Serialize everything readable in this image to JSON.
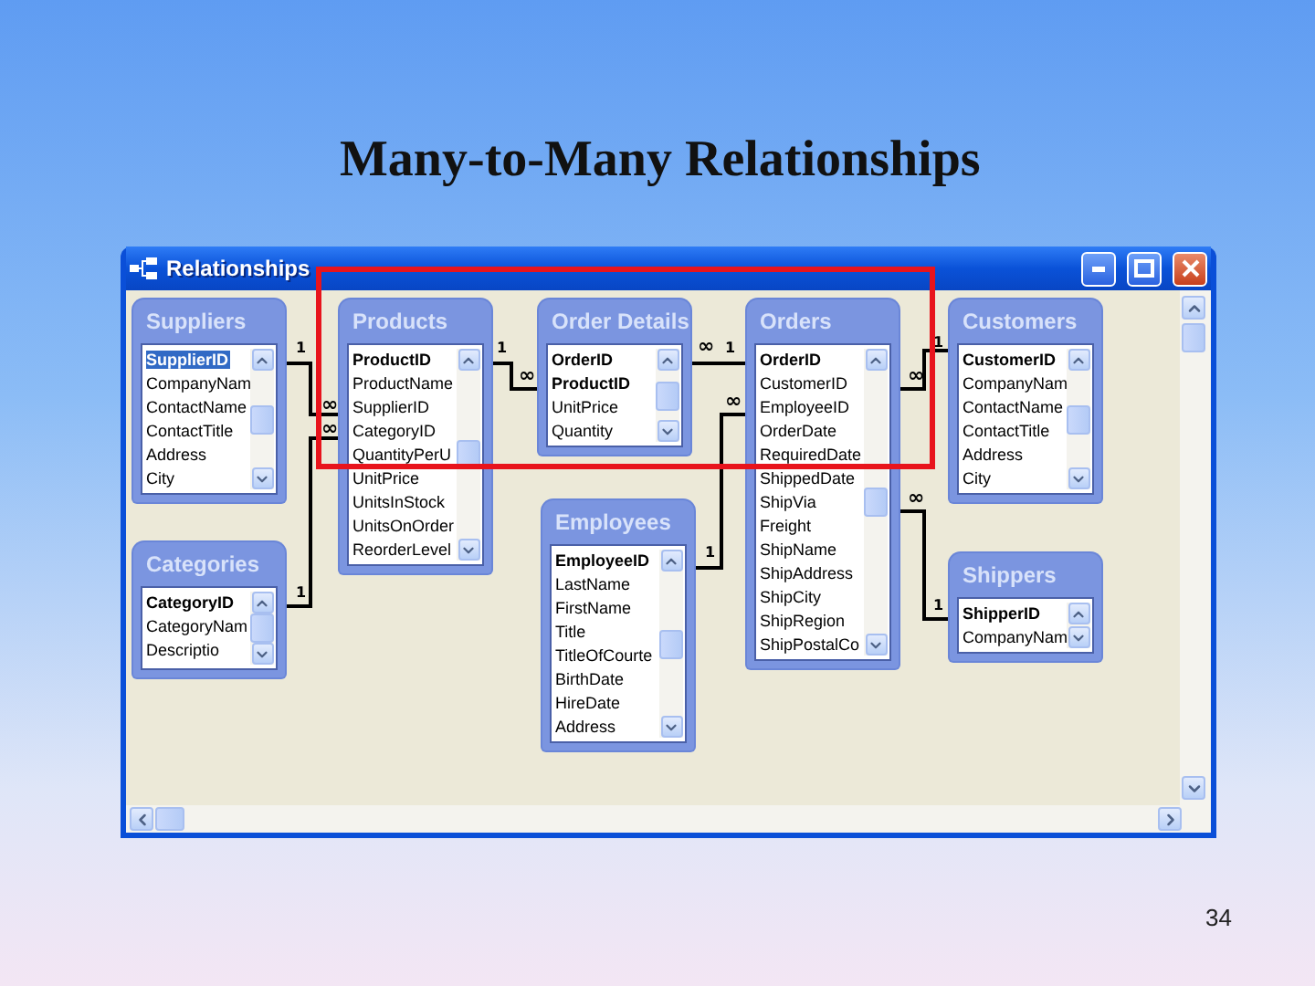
{
  "slide": {
    "title": "Many-to-Many Relationships",
    "page_number": "34"
  },
  "window": {
    "title": "Relationships"
  },
  "tables": [
    {
      "name": "Suppliers",
      "fields": [
        {
          "name": "SupplierID",
          "key": true,
          "selected": true
        },
        {
          "name": "CompanyNam",
          "key": false,
          "selected": false
        },
        {
          "name": "ContactName",
          "key": false,
          "selected": false
        },
        {
          "name": "ContactTitle",
          "key": false,
          "selected": false
        },
        {
          "name": "Address",
          "key": false,
          "selected": false
        },
        {
          "name": "City",
          "key": false,
          "selected": false
        }
      ]
    },
    {
      "name": "Products",
      "fields": [
        {
          "name": "ProductID",
          "key": true,
          "selected": false
        },
        {
          "name": "ProductName",
          "key": false,
          "selected": false
        },
        {
          "name": "SupplierID",
          "key": false,
          "selected": false
        },
        {
          "name": "CategoryID",
          "key": false,
          "selected": false
        },
        {
          "name": "QuantityPerU",
          "key": false,
          "selected": false
        },
        {
          "name": "UnitPrice",
          "key": false,
          "selected": false
        },
        {
          "name": "UnitsInStock",
          "key": false,
          "selected": false
        },
        {
          "name": "UnitsOnOrder",
          "key": false,
          "selected": false
        },
        {
          "name": "ReorderLevel",
          "key": false,
          "selected": false
        }
      ]
    },
    {
      "name": "Order Details",
      "fields": [
        {
          "name": "OrderID",
          "key": true,
          "selected": false
        },
        {
          "name": "ProductID",
          "key": true,
          "selected": false
        },
        {
          "name": "UnitPrice",
          "key": false,
          "selected": false
        },
        {
          "name": "Quantity",
          "key": false,
          "selected": false
        }
      ]
    },
    {
      "name": "Orders",
      "fields": [
        {
          "name": "OrderID",
          "key": true,
          "selected": false
        },
        {
          "name": "CustomerID",
          "key": false,
          "selected": false
        },
        {
          "name": "EmployeeID",
          "key": false,
          "selected": false
        },
        {
          "name": "OrderDate",
          "key": false,
          "selected": false
        },
        {
          "name": "RequiredDate",
          "key": false,
          "selected": false
        },
        {
          "name": "ShippedDate",
          "key": false,
          "selected": false
        },
        {
          "name": "ShipVia",
          "key": false,
          "selected": false
        },
        {
          "name": "Freight",
          "key": false,
          "selected": false
        },
        {
          "name": "ShipName",
          "key": false,
          "selected": false
        },
        {
          "name": "ShipAddress",
          "key": false,
          "selected": false
        },
        {
          "name": "ShipCity",
          "key": false,
          "selected": false
        },
        {
          "name": "ShipRegion",
          "key": false,
          "selected": false
        },
        {
          "name": "ShipPostalCo",
          "key": false,
          "selected": false
        }
      ]
    },
    {
      "name": "Customers",
      "fields": [
        {
          "name": "CustomerID",
          "key": true,
          "selected": false
        },
        {
          "name": "CompanyNam",
          "key": false,
          "selected": false
        },
        {
          "name": "ContactName",
          "key": false,
          "selected": false
        },
        {
          "name": "ContactTitle",
          "key": false,
          "selected": false
        },
        {
          "name": "Address",
          "key": false,
          "selected": false
        },
        {
          "name": "City",
          "key": false,
          "selected": false
        }
      ]
    },
    {
      "name": "Categories",
      "fields": [
        {
          "name": "CategoryID",
          "key": true,
          "selected": false
        },
        {
          "name": "CategoryNam",
          "key": false,
          "selected": false
        },
        {
          "name": "Descriptio",
          "key": false,
          "selected": false
        }
      ]
    },
    {
      "name": "Employees",
      "fields": [
        {
          "name": "EmployeeID",
          "key": true,
          "selected": false
        },
        {
          "name": "LastName",
          "key": false,
          "selected": false
        },
        {
          "name": "FirstName",
          "key": false,
          "selected": false
        },
        {
          "name": "Title",
          "key": false,
          "selected": false
        },
        {
          "name": "TitleOfCourte",
          "key": false,
          "selected": false
        },
        {
          "name": "BirthDate",
          "key": false,
          "selected": false
        },
        {
          "name": "HireDate",
          "key": false,
          "selected": false
        },
        {
          "name": "Address",
          "key": false,
          "selected": false
        }
      ]
    },
    {
      "name": "Shippers",
      "fields": [
        {
          "name": "ShipperID",
          "key": true,
          "selected": false
        },
        {
          "name": "CompanyNam",
          "key": false,
          "selected": false
        }
      ]
    }
  ],
  "relationships": [
    {
      "one": "1",
      "many": "∞"
    },
    {
      "one": "1",
      "many": "∞"
    },
    {
      "one": "1",
      "many": "∞"
    },
    {
      "one": "1",
      "many": "∞"
    },
    {
      "one": "1",
      "many": "∞"
    },
    {
      "one": "1",
      "many": "∞"
    },
    {
      "one": "1",
      "many": "∞"
    }
  ]
}
